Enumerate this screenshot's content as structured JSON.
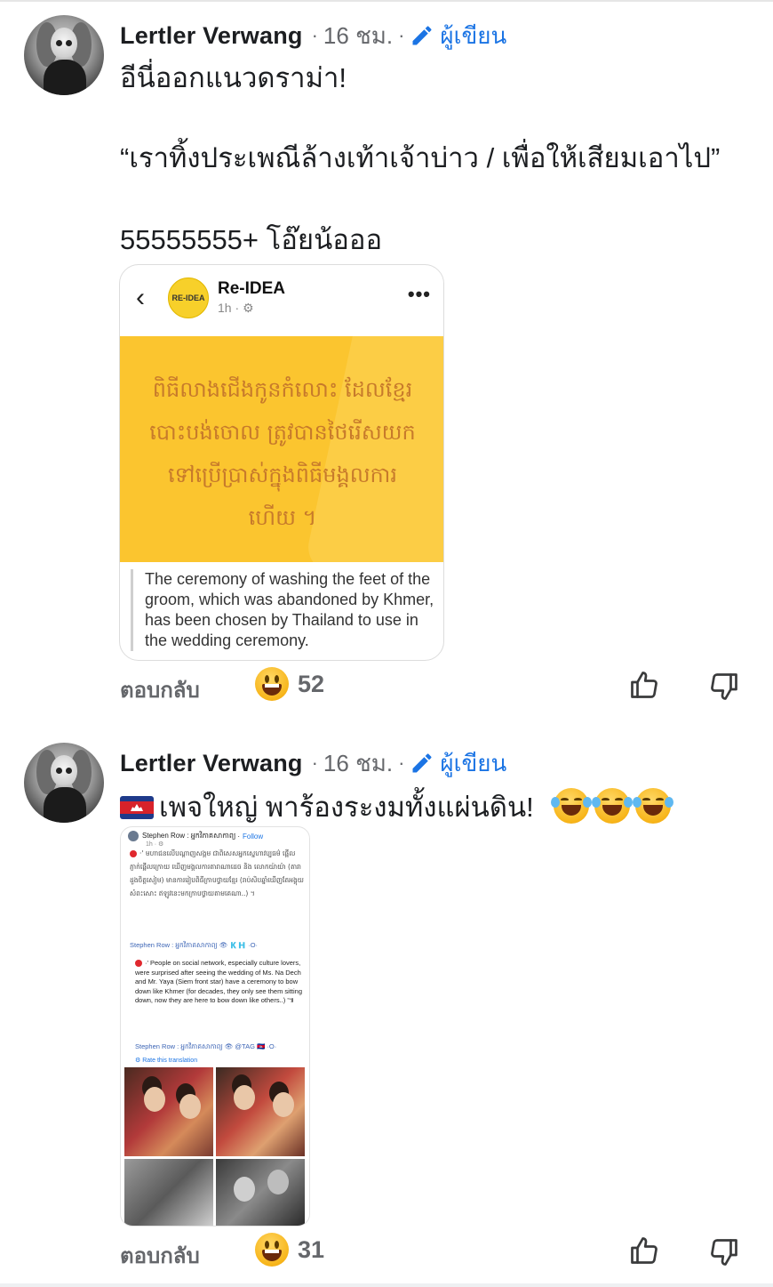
{
  "comments": [
    {
      "author": "Lertler Verwang",
      "time": "16 ชม.",
      "separator": "·",
      "badge": "ผู้เขียน",
      "lines": [
        "อีนี่ออกแนวดราม่า!",
        "“เราทิ้งประเพณีล้างเท้าเจ้าบ่าว / เพื่อให้เสียมเอาไป”",
        "55555555+ โอ๊ยน้อออ"
      ],
      "embed": {
        "page_name": "Re-IDEA",
        "page_time": "1h",
        "logo_text": "RE-IDEA",
        "khmer_text": "ពិធីលាងជើងកូនកំលោះ ដែលខ្មែរ\nបោះបង់ចោល ត្រូវបានថៃរើសយក\nទៅប្រើប្រាស់ក្នុងពិធីមង្គលការ\nហើយ ។",
        "caption": "The ceremony of washing the feet of the groom, which was abandoned by Khmer, has been chosen by Thailand to use in the wedding ceremony."
      },
      "reply_label": "ตอบกลับ",
      "reaction_count": "52"
    },
    {
      "author": "Lertler Verwang",
      "time": "16 ชม.",
      "separator": "·",
      "badge": "ผู้เขียน",
      "text": "เพจใหญ่ พาร้องระงมทั้งแผ่นดิน!",
      "embed": {
        "header": "Stephen Row : អ្នកវិភាគសាកាព្យ",
        "follow": "Follow",
        "time": "1h",
        "khmer_text": "·' មហាជនលើបណ្តាញសង្គម ជាពិសេសអ្នកស្នេហាវប្បធម៌ ផ្អើលភ្ញាក់ផ្អើលក្រោយ ឃើញមង្គលការតារាណាដេច និង លោកយ៉ាយ៉ា (តារាដួងចិត្តសៀម) មានការរៀបពិធីក្រាបថ្វាយខ្មែរ (រាប់សិបឆ្នាំឃើញតែអង្គុយសំពះសោះ ឥឡូវនេះមកក្រាបថ្វាយតាមគេណា..) ។",
        "handle_line_1": "Stephen Row : អ្នកវិភាគសាកាព្យ 👁 🇰🇭 ·O·",
        "english_text": "·' People on social network, especially culture lovers, were surprised after seeing the wedding of Ms. Na Dech and Mr. Yaya (Siem front star) have a ceremony to bow down like Khmer (for decades, they only see them sitting down, now they are here to bow down like others..) '៕",
        "handle_line_2": "Stephen Row : អ្នកវិភាគសាកាព្យ 👁 @TAG 🇰🇭 ·O·",
        "rate_link": "⚙ Rate this translation"
      },
      "reply_label": "ตอบกลับ",
      "reaction_count": "31"
    }
  ],
  "colors": {
    "link_blue": "#1b74e4",
    "meta_gray": "#65676b",
    "banner_yellow": "#fbc52f"
  },
  "icons": [
    "pencil-icon",
    "back-arrow-icon",
    "more-icon",
    "grinning-emoji-icon",
    "laughing-tears-emoji-icon",
    "cambodia-flag-icon",
    "thumbs-up-icon",
    "thumbs-down-icon"
  ]
}
